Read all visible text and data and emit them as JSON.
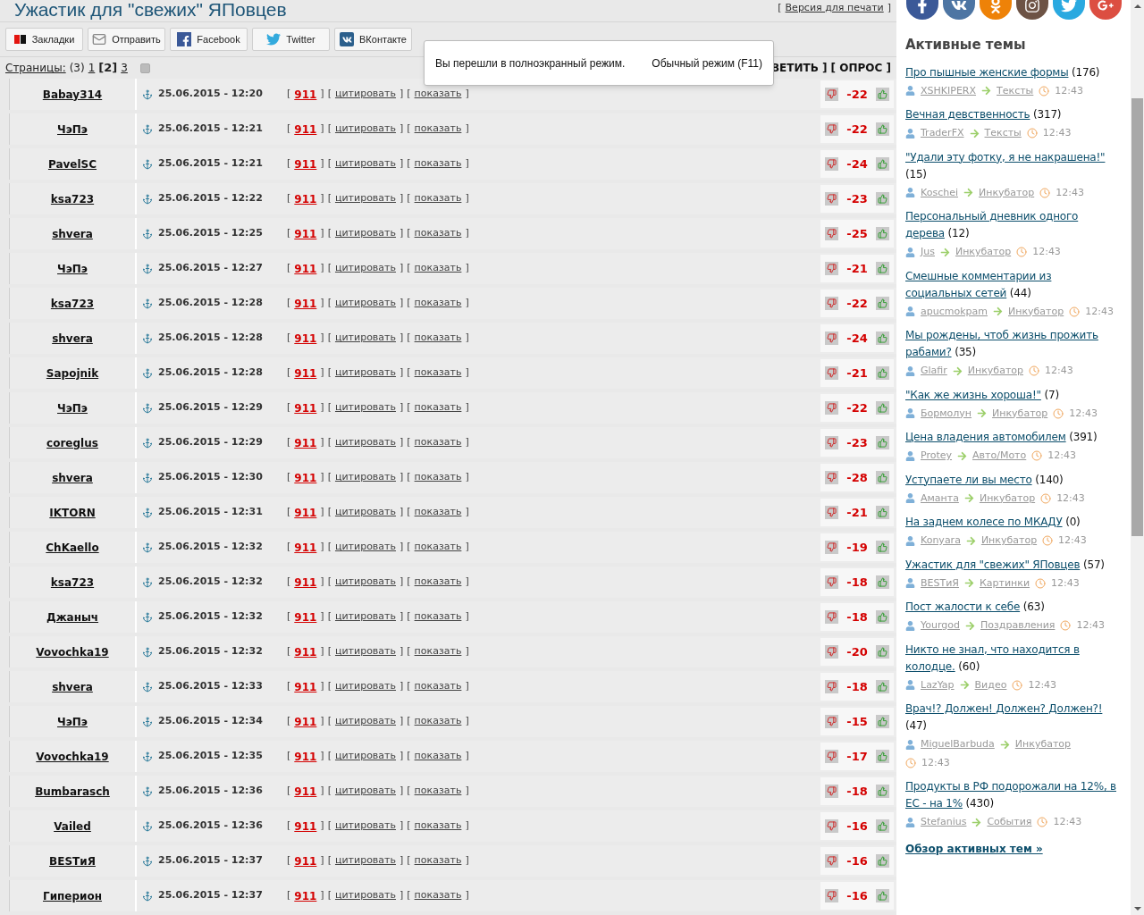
{
  "title": "Ужастик для \"свежих\" ЯПовцев",
  "print_link": {
    "open": "[",
    "label": "Версия для печати",
    "close": "]"
  },
  "share_buttons": [
    {
      "kind": "yandex",
      "label": "Закладки"
    },
    {
      "kind": "mail",
      "label": "Отправить"
    },
    {
      "kind": "facebook",
      "label": "Facebook"
    },
    {
      "kind": "twitter",
      "label": "Twitter"
    },
    {
      "kind": "vk",
      "label": "ВКонтакте"
    }
  ],
  "pages": {
    "label": "Страницы:",
    "total": "(3)",
    "items": [
      {
        "label": "1",
        "selected": false
      },
      {
        "label": "[2]",
        "selected": true
      },
      {
        "label": "3",
        "selected": false
      }
    ]
  },
  "thread_actions": "ВЕТИТЬ ] [ ОПРОС ]",
  "fullscreen_notice": {
    "message": "Вы перешли в полноэкранный режим.",
    "exit": "Обычный режим (F11)"
  },
  "posts": [
    {
      "user": "Babay314",
      "date": "25.06.2015 - 12:20",
      "brackets": [
        "[",
        "]"
      ],
      "actions": [
        {
          "kind": "alert",
          "label": "911"
        },
        {
          "kind": "link",
          "label": "цитировать"
        },
        {
          "kind": "link",
          "label": "показать"
        }
      ],
      "score": "-22"
    },
    {
      "user": "ЧэПэ",
      "date": "25.06.2015 - 12:21",
      "brackets": [
        "[",
        "]"
      ],
      "actions": [
        {
          "kind": "alert",
          "label": "911"
        },
        {
          "kind": "link",
          "label": "цитировать"
        },
        {
          "kind": "link",
          "label": "показать"
        }
      ],
      "score": "-22"
    },
    {
      "user": "PavelSC",
      "date": "25.06.2015 - 12:21",
      "brackets": [
        "[",
        "]"
      ],
      "actions": [
        {
          "kind": "alert",
          "label": "911"
        },
        {
          "kind": "link",
          "label": "цитировать"
        },
        {
          "kind": "link",
          "label": "показать"
        }
      ],
      "score": "-24"
    },
    {
      "user": "ksa723",
      "date": "25.06.2015 - 12:22",
      "brackets": [
        "[",
        "]"
      ],
      "actions": [
        {
          "kind": "alert",
          "label": "911"
        },
        {
          "kind": "link",
          "label": "цитировать"
        },
        {
          "kind": "link",
          "label": "показать"
        }
      ],
      "score": "-23"
    },
    {
      "user": "shvera",
      "date": "25.06.2015 - 12:25",
      "brackets": [
        "[",
        "]"
      ],
      "actions": [
        {
          "kind": "alert",
          "label": "911"
        },
        {
          "kind": "link",
          "label": "цитировать"
        },
        {
          "kind": "link",
          "label": "показать"
        }
      ],
      "score": "-25"
    },
    {
      "user": "ЧэПэ",
      "date": "25.06.2015 - 12:27",
      "brackets": [
        "[",
        "]"
      ],
      "actions": [
        {
          "kind": "alert",
          "label": "911"
        },
        {
          "kind": "link",
          "label": "цитировать"
        },
        {
          "kind": "link",
          "label": "показать"
        }
      ],
      "score": "-21"
    },
    {
      "user": "ksa723",
      "date": "25.06.2015 - 12:28",
      "brackets": [
        "[",
        "]"
      ],
      "actions": [
        {
          "kind": "alert",
          "label": "911"
        },
        {
          "kind": "link",
          "label": "цитировать"
        },
        {
          "kind": "link",
          "label": "показать"
        }
      ],
      "score": "-22"
    },
    {
      "user": "shvera",
      "date": "25.06.2015 - 12:28",
      "brackets": [
        "[",
        "]"
      ],
      "actions": [
        {
          "kind": "alert",
          "label": "911"
        },
        {
          "kind": "link",
          "label": "цитировать"
        },
        {
          "kind": "link",
          "label": "показать"
        }
      ],
      "score": "-24"
    },
    {
      "user": "Sapojnik",
      "date": "25.06.2015 - 12:28",
      "brackets": [
        "[",
        "]"
      ],
      "actions": [
        {
          "kind": "alert",
          "label": "911"
        },
        {
          "kind": "link",
          "label": "цитировать"
        },
        {
          "kind": "link",
          "label": "показать"
        }
      ],
      "score": "-21"
    },
    {
      "user": "ЧэПэ",
      "date": "25.06.2015 - 12:29",
      "brackets": [
        "[",
        "]"
      ],
      "actions": [
        {
          "kind": "alert",
          "label": "911"
        },
        {
          "kind": "link",
          "label": "цитировать"
        },
        {
          "kind": "link",
          "label": "показать"
        }
      ],
      "score": "-22"
    },
    {
      "user": "coreglus",
      "date": "25.06.2015 - 12:29",
      "brackets": [
        "[",
        "]"
      ],
      "actions": [
        {
          "kind": "alert",
          "label": "911"
        },
        {
          "kind": "link",
          "label": "цитировать"
        },
        {
          "kind": "link",
          "label": "показать"
        }
      ],
      "score": "-23"
    },
    {
      "user": "shvera",
      "date": "25.06.2015 - 12:30",
      "brackets": [
        "[",
        "]"
      ],
      "actions": [
        {
          "kind": "alert",
          "label": "911"
        },
        {
          "kind": "link",
          "label": "цитировать"
        },
        {
          "kind": "link",
          "label": "показать"
        }
      ],
      "score": "-28"
    },
    {
      "user": "IKTORN",
      "date": "25.06.2015 - 12:31",
      "brackets": [
        "[",
        "]"
      ],
      "actions": [
        {
          "kind": "alert",
          "label": "911"
        },
        {
          "kind": "link",
          "label": "цитировать"
        },
        {
          "kind": "link",
          "label": "показать"
        }
      ],
      "score": "-21"
    },
    {
      "user": "ChKaello",
      "date": "25.06.2015 - 12:32",
      "brackets": [
        "[",
        "]"
      ],
      "actions": [
        {
          "kind": "alert",
          "label": "911"
        },
        {
          "kind": "link",
          "label": "цитировать"
        },
        {
          "kind": "link",
          "label": "показать"
        }
      ],
      "score": "-19"
    },
    {
      "user": "ksa723",
      "date": "25.06.2015 - 12:32",
      "brackets": [
        "[",
        "]"
      ],
      "actions": [
        {
          "kind": "alert",
          "label": "911"
        },
        {
          "kind": "link",
          "label": "цитировать"
        },
        {
          "kind": "link",
          "label": "показать"
        }
      ],
      "score": "-18"
    },
    {
      "user": "Джаныч",
      "date": "25.06.2015 - 12:32",
      "brackets": [
        "[",
        "]"
      ],
      "actions": [
        {
          "kind": "alert",
          "label": "911"
        },
        {
          "kind": "link",
          "label": "цитировать"
        },
        {
          "kind": "link",
          "label": "показать"
        }
      ],
      "score": "-18"
    },
    {
      "user": "Vovochka19",
      "date": "25.06.2015 - 12:32",
      "brackets": [
        "[",
        "]"
      ],
      "actions": [
        {
          "kind": "alert",
          "label": "911"
        },
        {
          "kind": "link",
          "label": "цитировать"
        },
        {
          "kind": "link",
          "label": "показать"
        }
      ],
      "score": "-20"
    },
    {
      "user": "shvera",
      "date": "25.06.2015 - 12:33",
      "brackets": [
        "[",
        "]"
      ],
      "actions": [
        {
          "kind": "alert",
          "label": "911"
        },
        {
          "kind": "link",
          "label": "цитировать"
        },
        {
          "kind": "link",
          "label": "показать"
        }
      ],
      "score": "-18"
    },
    {
      "user": "ЧэПэ",
      "date": "25.06.2015 - 12:34",
      "brackets": [
        "[",
        "]"
      ],
      "actions": [
        {
          "kind": "alert",
          "label": "911"
        },
        {
          "kind": "link",
          "label": "цитировать"
        },
        {
          "kind": "link",
          "label": "показать"
        }
      ],
      "score": "-15"
    },
    {
      "user": "Vovochka19",
      "date": "25.06.2015 - 12:35",
      "brackets": [
        "[",
        "]"
      ],
      "actions": [
        {
          "kind": "alert",
          "label": "911"
        },
        {
          "kind": "link",
          "label": "цитировать"
        },
        {
          "kind": "link",
          "label": "показать"
        }
      ],
      "score": "-17"
    },
    {
      "user": "Bumbarasch",
      "date": "25.06.2015 - 12:36",
      "brackets": [
        "[",
        "]"
      ],
      "actions": [
        {
          "kind": "alert",
          "label": "911"
        },
        {
          "kind": "link",
          "label": "цитировать"
        },
        {
          "kind": "link",
          "label": "показать"
        }
      ],
      "score": "-18"
    },
    {
      "user": "Vailed",
      "date": "25.06.2015 - 12:36",
      "brackets": [
        "[",
        "]"
      ],
      "actions": [
        {
          "kind": "alert",
          "label": "911"
        },
        {
          "kind": "link",
          "label": "цитировать"
        },
        {
          "kind": "link",
          "label": "показать"
        }
      ],
      "score": "-16"
    },
    {
      "user": "BESTиЯ",
      "date": "25.06.2015 - 12:37",
      "brackets": [
        "[",
        "]"
      ],
      "actions": [
        {
          "kind": "alert",
          "label": "911"
        },
        {
          "kind": "link",
          "label": "цитировать"
        },
        {
          "kind": "link",
          "label": "показать"
        }
      ],
      "score": "-16"
    },
    {
      "user": "Гиперион",
      "date": "25.06.2015 - 12:37",
      "brackets": [
        "[",
        "]"
      ],
      "actions": [
        {
          "kind": "alert",
          "label": "911"
        },
        {
          "kind": "link",
          "label": "цитировать"
        },
        {
          "kind": "link",
          "label": "показать"
        }
      ],
      "score": "-16"
    }
  ],
  "social_links": [
    {
      "kind": "facebook",
      "color": "#3b5998"
    },
    {
      "kind": "vk",
      "color": "#4d75a3"
    },
    {
      "kind": "ok",
      "color": "#ee8208"
    },
    {
      "kind": "instagram",
      "color": "#6d5345"
    },
    {
      "kind": "twitter",
      "color": "#2aa9e0"
    },
    {
      "kind": "googleplus",
      "color": "#dc4e41"
    }
  ],
  "sidebar": {
    "heading": "Активные темы",
    "topics": [
      {
        "title": "Про пышные женские формы",
        "count": "(176)",
        "user": "XSHKIPERX",
        "category": "Тексты",
        "time": "12:43"
      },
      {
        "title": "Вечная девственность",
        "count": "(317)",
        "user": "TraderFX",
        "category": "Тексты",
        "time": "12:43"
      },
      {
        "title": "\"Удали эту фотку, я не накрашена!\"",
        "count": "(15)",
        "user": "Koschei",
        "category": "Инкубатор",
        "time": "12:43"
      },
      {
        "title": "Персональный дневник одного дерева",
        "count": "(12)",
        "user": "Jus",
        "category": "Инкубатор",
        "time": "12:43"
      },
      {
        "title": "Смешные комментарии из социальных сетей",
        "count": "(44)",
        "user": "apucmokpam",
        "category": "Инкубатор",
        "time": "12:43"
      },
      {
        "title": "Мы рождены, чтоб жизнь прожить рабами?",
        "count": "(35)",
        "user": "Glafir",
        "category": "Инкубатор",
        "time": "12:43"
      },
      {
        "title": "\"Как же жизнь хороша!\"",
        "count": "(7)",
        "user": "Бормолун",
        "category": "Инкубатор",
        "time": "12:43"
      },
      {
        "title": "Цена владения автомобилем",
        "count": "(391)",
        "user": "Protey",
        "category": "Авто/Мото",
        "time": "12:43"
      },
      {
        "title": "Уступаете ли вы место",
        "count": "(140)",
        "user": "Аманта",
        "category": "Инкубатор",
        "time": "12:43"
      },
      {
        "title": "На заднем колесе по МКАДУ",
        "count": "(0)",
        "user": "Konyara",
        "category": "Инкубатор",
        "time": "12:43"
      },
      {
        "title": "Ужастик для \"свежих\" ЯПовцев",
        "count": "(57)",
        "user": "BESTиЯ",
        "category": "Картинки",
        "time": "12:43"
      },
      {
        "title": "Пост жалости к себе",
        "count": "(63)",
        "user": "Yourgod",
        "category": "Поздравления",
        "time": "12:43"
      },
      {
        "title": "Никто не знал, что находится в колодце.",
        "count": "(60)",
        "user": "LazYap",
        "category": "Видео",
        "time": "12:43"
      },
      {
        "title": "Врач!? Должен! Должен? Должен?!",
        "count": "(47)",
        "user": "MiguelBarbuda",
        "category": "Инкубатор",
        "time": "12:43"
      },
      {
        "title": "Продукты в РФ подорожали на 12%, в ЕС - на 1%",
        "count": "(430)",
        "user": "Stefanius",
        "category": "События",
        "time": "12:43"
      }
    ],
    "more_link": "Обзор активных тем »"
  }
}
